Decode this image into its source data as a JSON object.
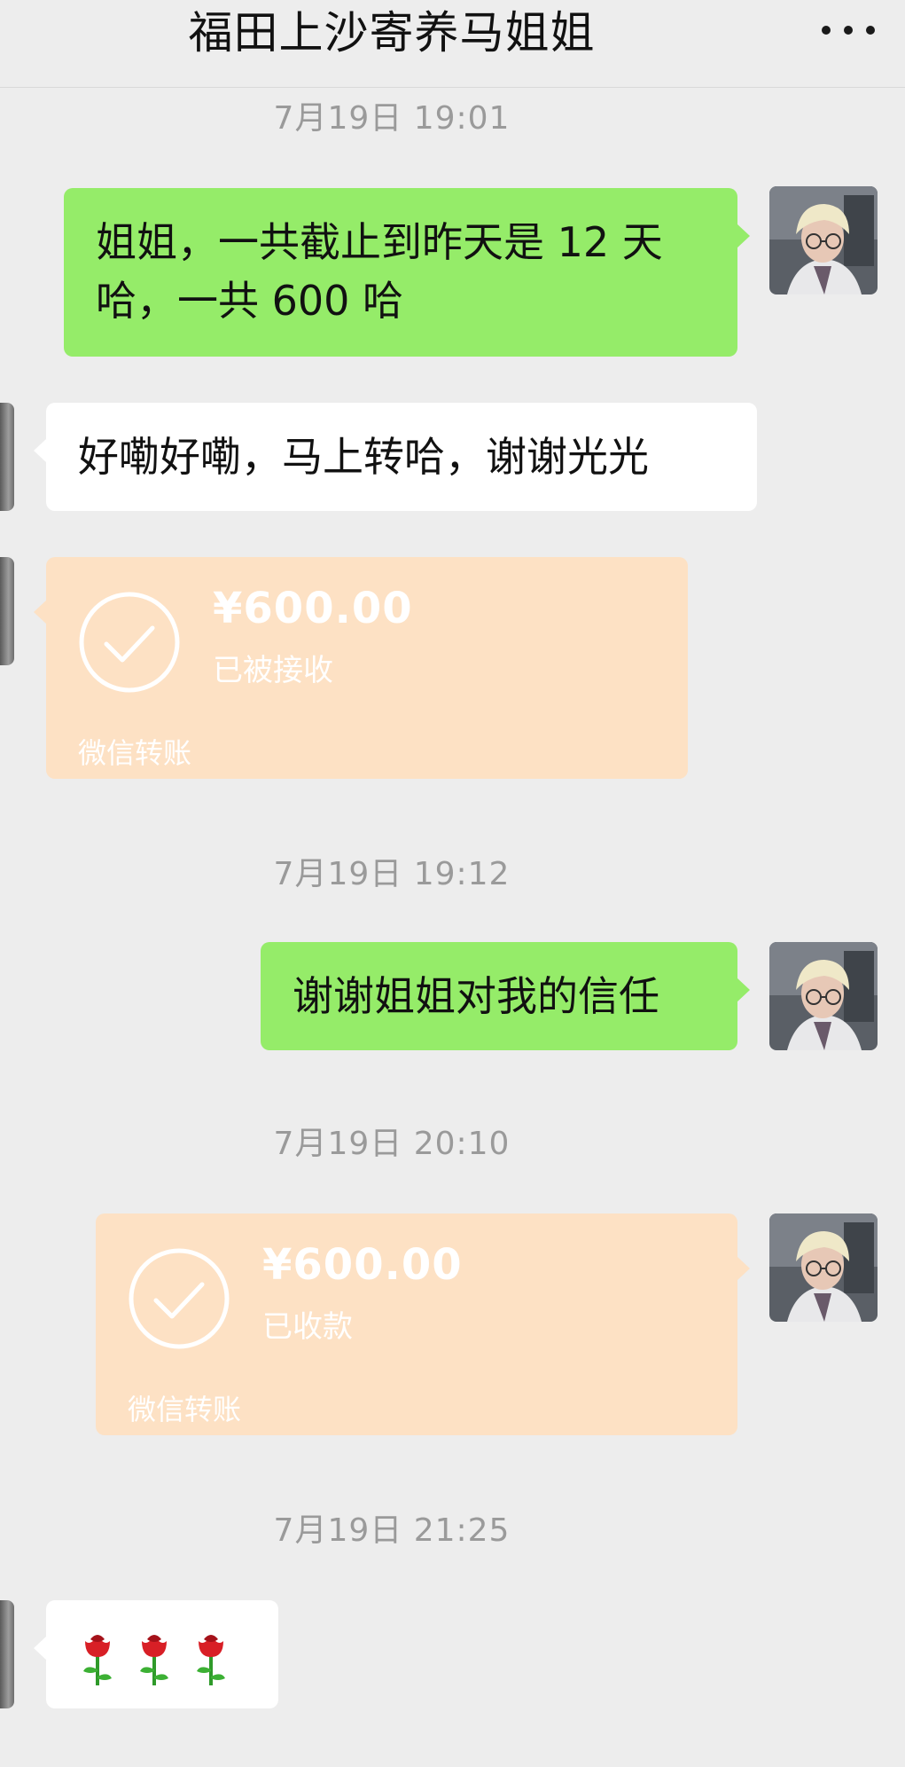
{
  "header": {
    "title": "福田上沙寄养马姐姐",
    "more_icon": "more-dots-icon"
  },
  "messages": {
    "t1": "7月19日 19:01",
    "m1": {
      "line1": "姐姐，一共截止到昨天是 12 天",
      "line2": "哈，一共 600 哈"
    },
    "m2": "好嘞好嘞，马上转哈，谢谢光光",
    "transfer1": {
      "amount": "¥600.00",
      "status": "已被接收",
      "footer": "微信转账"
    },
    "t2": "7月19日 19:12",
    "m3": "谢谢姐姐对我的信任",
    "t3": "7月19日 20:10",
    "transfer2": {
      "amount": "¥600.00",
      "status": "已收款",
      "footer": "微信转账"
    },
    "t4": "7月19日 21:25",
    "m4_icons": [
      "rose-icon",
      "rose-icon",
      "rose-icon"
    ]
  },
  "colors": {
    "background": "#ededed",
    "self_bubble": "#95ec69",
    "other_bubble": "#ffffff",
    "transfer_card": "#fde1c4",
    "timestamp": "#9a9a9a"
  }
}
